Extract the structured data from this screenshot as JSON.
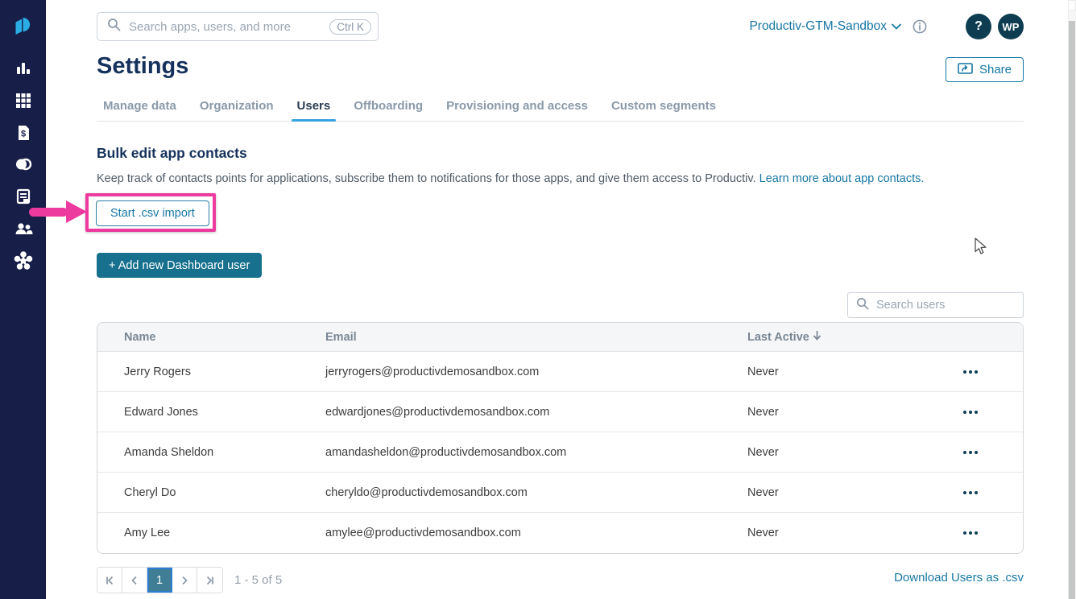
{
  "colors": {
    "sidebar_bg": "#171e48",
    "logo_cyan": "#29ade4",
    "accent_teal": "#1577a3",
    "button_teal": "#16708e",
    "dark_circle": "#0e3d52",
    "annotation_magenta": "#ed3a9e",
    "tab_underline_blue": "#35a3e0",
    "active_page_bg": "#3f7e95"
  },
  "sidebar": {
    "icons": [
      "productiv-logo",
      "analytics-bar-chart",
      "apps-grid",
      "spend-document",
      "overlap-venn",
      "contracts-ledger",
      "teams-people",
      "integrations-asterisk"
    ]
  },
  "topbar": {
    "search_placeholder": "Search apps, users, and more",
    "shortcut": "Ctrl K",
    "workspace": "Productiv-GTM-Sandbox",
    "help_label": "?",
    "avatar_initials": "WP"
  },
  "header": {
    "title": "Settings",
    "share_label": "Share"
  },
  "tabs": [
    {
      "label": "Manage data"
    },
    {
      "label": "Organization"
    },
    {
      "label": "Users",
      "active": true
    },
    {
      "label": "Offboarding"
    },
    {
      "label": "Provisioning and access"
    },
    {
      "label": "Custom segments"
    }
  ],
  "bulk": {
    "heading": "Bulk edit app contacts",
    "description": "Keep track of contacts points for applications, subscribe them to notifications for those apps, and give them access to Productiv. ",
    "link": "Learn more about app contacts.",
    "csv_button": "Start .csv import",
    "add_user_button": "+ Add new Dashboard user"
  },
  "users": {
    "search_placeholder": "Search users",
    "columns": {
      "name": "Name",
      "email": "Email",
      "last_active": "Last Active"
    },
    "rows": [
      {
        "name": "Jerry Rogers",
        "email": "jerryrogers@productivdemosandbox.com",
        "last_active": "Never"
      },
      {
        "name": "Edward Jones",
        "email": "edwardjones@productivdemosandbox.com",
        "last_active": "Never"
      },
      {
        "name": "Amanda Sheldon",
        "email": "amandasheldon@productivdemosandbox.com",
        "last_active": "Never"
      },
      {
        "name": "Cheryl Do",
        "email": "cheryldo@productivdemosandbox.com",
        "last_active": "Never"
      },
      {
        "name": "Amy Lee",
        "email": "amylee@productivdemosandbox.com",
        "last_active": "Never"
      }
    ],
    "pagination": {
      "current_page": "1",
      "range": "1 - 5 of 5"
    },
    "download_link": "Download Users as .csv"
  }
}
